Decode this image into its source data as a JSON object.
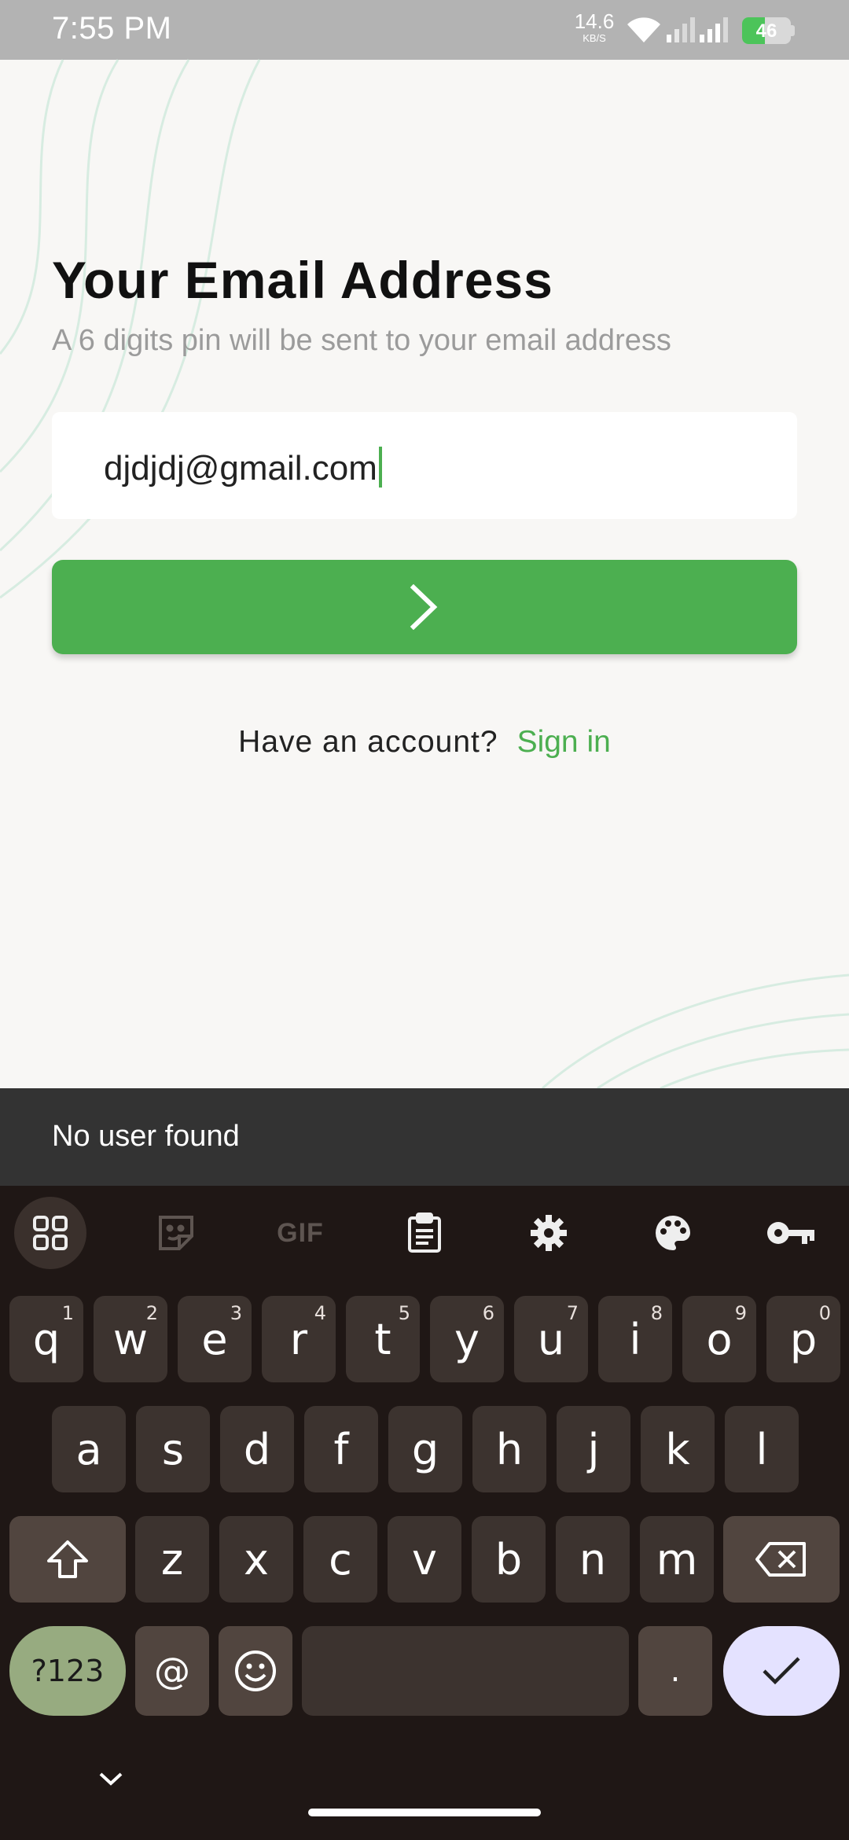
{
  "status_bar": {
    "time": "7:55 PM",
    "net_speed_value": "14.6",
    "net_speed_unit": "KB/S",
    "battery_percent": "46"
  },
  "screen": {
    "title": "Your Email Address",
    "subtitle": "A 6 digits pin will be sent to your email address",
    "email_value": "djdjdj@gmail.com",
    "next_button_icon": "chevron-right-icon",
    "have_account_text": "Have an account?",
    "sign_in_label": "Sign in",
    "accent_color": "#4caf50"
  },
  "snackbar": {
    "message": "No user found"
  },
  "keyboard": {
    "toolbar": {
      "gif_label": "GIF",
      "icons": [
        "apps-grid-icon",
        "sticker-icon",
        "gif-icon",
        "clipboard-icon",
        "gear-icon",
        "palette-icon",
        "key-icon"
      ]
    },
    "row1": [
      {
        "k": "q",
        "h": "1"
      },
      {
        "k": "w",
        "h": "2"
      },
      {
        "k": "e",
        "h": "3"
      },
      {
        "k": "r",
        "h": "4"
      },
      {
        "k": "t",
        "h": "5"
      },
      {
        "k": "y",
        "h": "6"
      },
      {
        "k": "u",
        "h": "7"
      },
      {
        "k": "i",
        "h": "8"
      },
      {
        "k": "o",
        "h": "9"
      },
      {
        "k": "p",
        "h": "0"
      }
    ],
    "row2": [
      "a",
      "s",
      "d",
      "f",
      "g",
      "h",
      "j",
      "k",
      "l"
    ],
    "row3": [
      "z",
      "x",
      "c",
      "v",
      "b",
      "n",
      "m"
    ],
    "symbols_label": "?123",
    "at_label": "@",
    "period_label": "."
  }
}
